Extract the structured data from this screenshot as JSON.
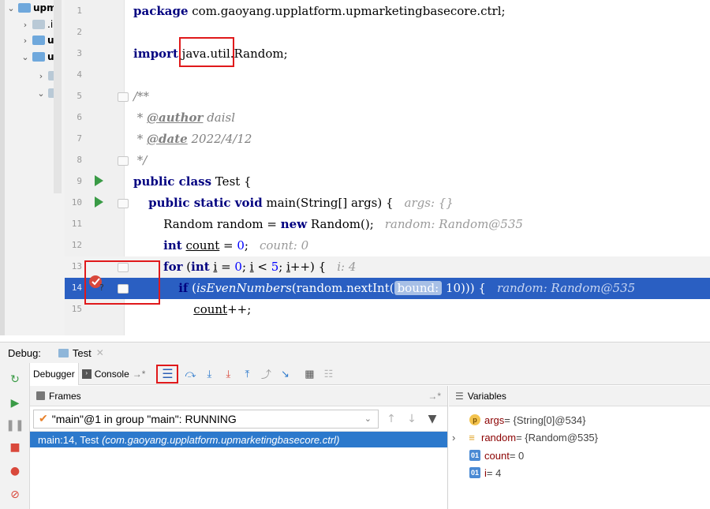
{
  "project": {
    "items": [
      {
        "chevron": "⌄",
        "label": "upm"
      },
      {
        "chevron": "›",
        "label": ".i"
      },
      {
        "chevron": "›",
        "label": "u"
      },
      {
        "chevron": "⌄",
        "label": "u"
      },
      {
        "chevron": "›",
        "label": ""
      },
      {
        "chevron": "⌄",
        "label": ""
      }
    ]
  },
  "editor": {
    "lines": [
      {
        "n": "1",
        "parts": [
          [
            "kw",
            "package"
          ],
          [
            "",
            " com.gaoyang.upplatform.upmarketingbasecore.ctrl;"
          ]
        ]
      },
      {
        "n": "2",
        "parts": []
      },
      {
        "n": "3",
        "parts": [
          [
            "kw",
            "import"
          ],
          [
            "",
            " java.util.Random;"
          ]
        ]
      },
      {
        "n": "4",
        "parts": []
      },
      {
        "n": "5",
        "parts": [
          [
            "cm",
            "/**"
          ]
        ]
      },
      {
        "n": "6",
        "parts": [
          [
            "cm",
            " * "
          ],
          [
            "tag",
            "@author"
          ],
          [
            "cm",
            " daisl"
          ]
        ]
      },
      {
        "n": "7",
        "parts": [
          [
            "cm",
            " * "
          ],
          [
            "tag",
            "@date"
          ],
          [
            "cm",
            " 2022/4/12"
          ]
        ]
      },
      {
        "n": "8",
        "parts": [
          [
            "cm",
            " */"
          ]
        ]
      },
      {
        "n": "9",
        "parts": [
          [
            "kw",
            "public class"
          ],
          [
            "",
            " Test {"
          ]
        ]
      },
      {
        "n": "10",
        "parts": [
          [
            "",
            "    "
          ],
          [
            "kw",
            "public static void"
          ],
          [
            "",
            " main(String[] args) {"
          ],
          [
            "hint",
            "args: {}"
          ]
        ]
      },
      {
        "n": "11",
        "parts": [
          [
            "",
            "        Random random = "
          ],
          [
            "kw",
            "new"
          ],
          [
            "",
            " Random();"
          ],
          [
            "hint",
            "random: Random@535"
          ]
        ]
      },
      {
        "n": "12",
        "parts": [
          [
            "",
            "        "
          ],
          [
            "kw",
            "int"
          ],
          [
            "",
            " "
          ],
          [
            "ul",
            "count"
          ],
          [
            "",
            " = "
          ],
          [
            "num",
            "0"
          ],
          [
            "",
            ";"
          ],
          [
            "hint",
            "count: 0"
          ]
        ]
      },
      {
        "n": "13",
        "parts": [
          [
            "",
            "        "
          ],
          [
            "kw",
            "for"
          ],
          [
            "",
            " ("
          ],
          [
            "kw",
            "int"
          ],
          [
            "",
            " "
          ],
          [
            "ul",
            "i"
          ],
          [
            "",
            " = "
          ],
          [
            "num",
            "0"
          ],
          [
            "",
            "; "
          ],
          [
            "ul",
            "i"
          ],
          [
            "",
            " < "
          ],
          [
            "num",
            "5"
          ],
          [
            "",
            "; "
          ],
          [
            "ul",
            "i"
          ],
          [
            "",
            "++) {"
          ],
          [
            "hint",
            "i: 4"
          ]
        ]
      },
      {
        "n": "14",
        "parts": [
          [
            "",
            "            "
          ],
          [
            "kw",
            "if"
          ],
          [
            "",
            " ("
          ],
          [
            "it",
            "isEvenNumbers"
          ],
          [
            "",
            "(random.nextInt("
          ],
          [
            "pill",
            "bound:"
          ],
          [
            "",
            " 10))) {"
          ],
          [
            "hint",
            "random: Random@535"
          ]
        ]
      },
      {
        "n": "15",
        "parts": [
          [
            "",
            "                "
          ],
          [
            "ul",
            "count"
          ],
          [
            "",
            "++;"
          ]
        ]
      }
    ]
  },
  "debug": {
    "title": "Debug:",
    "session_tab": "Test",
    "toolbar": {
      "debugger_tab": "Debugger",
      "console_tab": "Console"
    },
    "frames": {
      "header": "Frames",
      "thread": "\"main\"@1 in group \"main\": RUNNING",
      "frame_location": "main:14, Test",
      "frame_package": "(com.gaoyang.upplatform.upmarketingbasecore.ctrl)"
    },
    "variables": {
      "header": "Variables",
      "items": [
        {
          "badge": "p",
          "name": "args",
          "value": " = {String[0]@534}"
        },
        {
          "badge": "≡",
          "name": "random",
          "value": " = {Random@535}"
        },
        {
          "badge": "01",
          "name": "count",
          "value": " = 0"
        },
        {
          "badge": "01",
          "name": "i",
          "value": " = 4"
        }
      ]
    }
  },
  "colors": {
    "execution_line": "#2a5fc2",
    "selected_frame": "#2c79cc",
    "keyword": "#000080",
    "annotation_box": "#e0191b"
  }
}
